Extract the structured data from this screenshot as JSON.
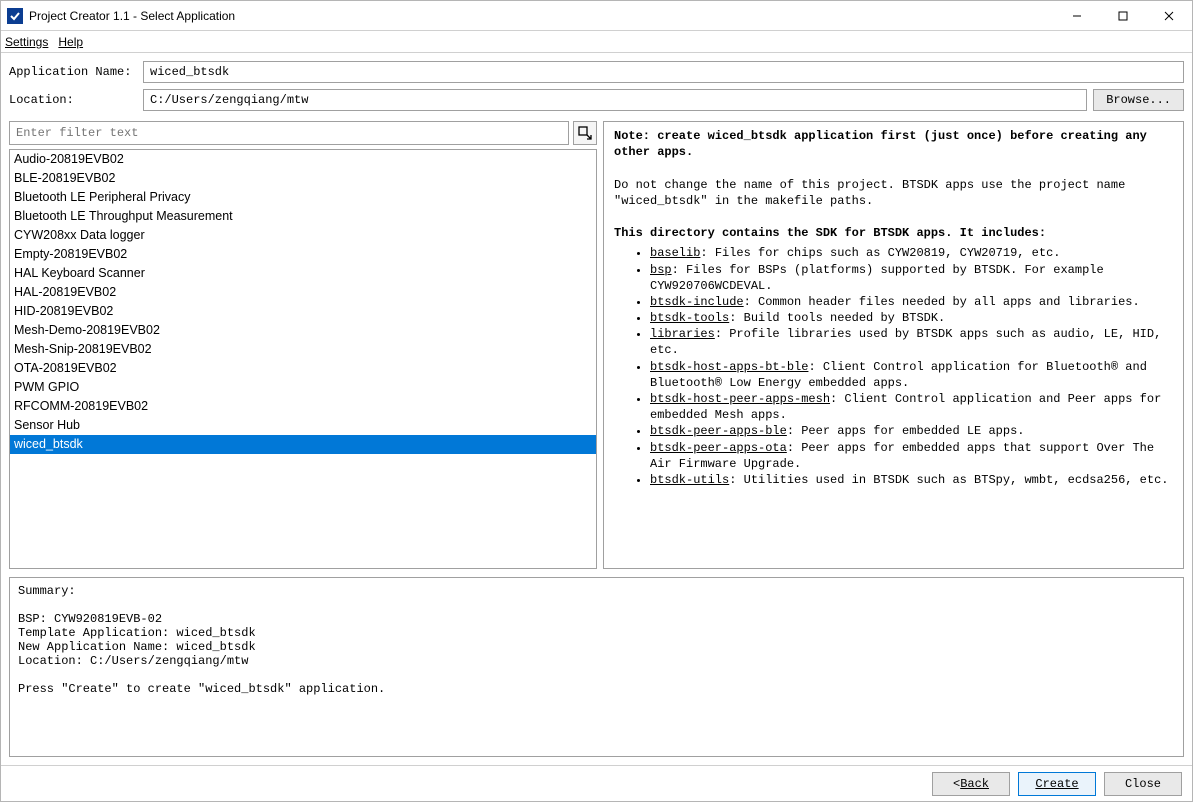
{
  "window": {
    "title": "Project Creator 1.1 - Select Application"
  },
  "menu": {
    "settings": "Settings",
    "help": "Help"
  },
  "fields": {
    "app_name_label": "Application Name:",
    "app_name_value": "wiced_btsdk",
    "location_label": "Location:",
    "location_value": "C:/Users/zengqiang/mtw",
    "browse_label": "Browse..."
  },
  "filter": {
    "placeholder": "Enter filter text"
  },
  "application_list": {
    "items": [
      "Audio-20819EVB02",
      "BLE-20819EVB02",
      "Bluetooth LE Peripheral Privacy",
      "Bluetooth LE Throughput Measurement",
      "CYW208xx Data logger",
      "Empty-20819EVB02",
      "HAL Keyboard Scanner",
      "HAL-20819EVB02",
      "HID-20819EVB02",
      "Mesh-Demo-20819EVB02",
      "Mesh-Snip-20819EVB02",
      "OTA-20819EVB02",
      "PWM GPIO",
      "RFCOMM-20819EVB02",
      "Sensor Hub",
      "wiced_btsdk"
    ],
    "selected_index": 15
  },
  "description": {
    "note_heading": "Note: create wiced_btsdk application first (just once) before creating any other apps.",
    "para1": "Do not change the name of this project.  BTSDK apps use the project name \"wiced_btsdk\" in the makefile paths.",
    "para2": "This directory contains the SDK for BTSDK apps. It includes:",
    "bullets": [
      {
        "term": "baselib",
        "text": ": Files for chips such as CYW20819, CYW20719, etc."
      },
      {
        "term": "bsp",
        "text": ": Files for BSPs (platforms) supported by BTSDK. For example CYW920706WCDEVAL."
      },
      {
        "term": "btsdk-include",
        "text": ": Common header files needed by all apps and libraries."
      },
      {
        "term": "btsdk-tools",
        "text": ": Build tools needed by BTSDK."
      },
      {
        "term": "libraries",
        "text": ": Profile libraries used by BTSDK apps such as audio, LE, HID, etc."
      },
      {
        "term": "btsdk-host-apps-bt-ble",
        "text": ": Client Control application for Bluetooth® and Bluetooth® Low Energy embedded apps."
      },
      {
        "term": "btsdk-host-peer-apps-mesh",
        "text": ": Client Control application and Peer apps for embedded Mesh apps."
      },
      {
        "term": "btsdk-peer-apps-ble",
        "text": ": Peer apps for embedded LE apps."
      },
      {
        "term": "btsdk-peer-apps-ota",
        "text": ": Peer apps for embedded apps that support Over The Air Firmware Upgrade."
      },
      {
        "term": "btsdk-utils",
        "text": ": Utilities used in BTSDK such as BTSpy, wmbt, ecdsa256, etc."
      }
    ]
  },
  "summary": {
    "heading": "Summary:",
    "bsp": "BSP: CYW920819EVB-02",
    "template": "Template Application: wiced_btsdk",
    "newname": "New Application Name: wiced_btsdk",
    "location": "Location: C:/Users/zengqiang/mtw",
    "prompt": "Press \"Create\" to create \"wiced_btsdk\" application."
  },
  "footer": {
    "back": "Back",
    "create": "Create",
    "close": "Close"
  }
}
